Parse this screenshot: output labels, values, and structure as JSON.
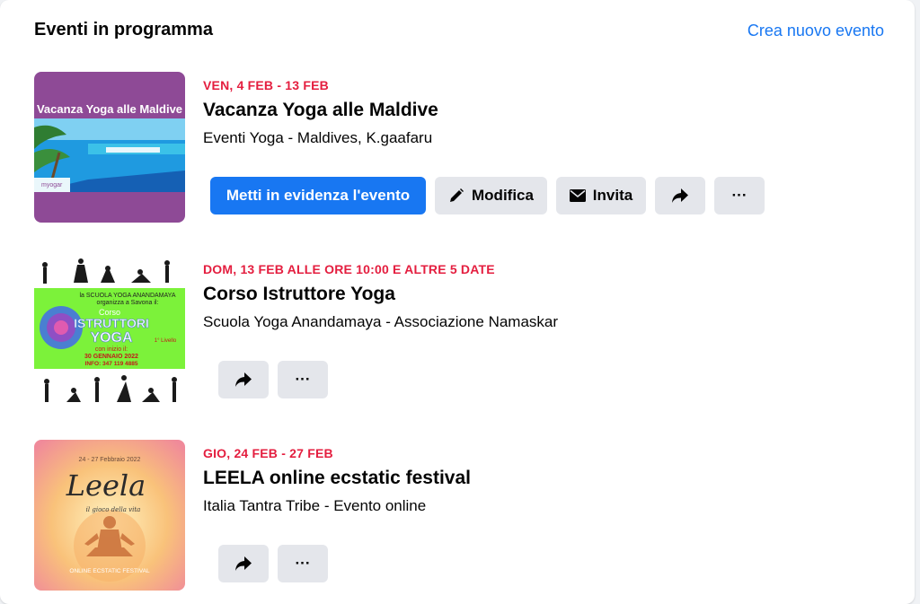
{
  "header": {
    "title": "Eventi in programma",
    "create_link": "Crea nuovo evento"
  },
  "events": [
    {
      "date": "VEN, 4 FEB - 13 FEB",
      "title": "Vacanza Yoga alle Maldive",
      "subtitle": "Eventi Yoga - Maldives, K.gaafaru",
      "thumb_text": "Vacanza Yoga alle Maldive",
      "thumb_small": "myogar",
      "buttons": {
        "promote": "Metti in evidenza l'evento",
        "edit": "Modifica",
        "invite": "Invita",
        "more": "···"
      }
    },
    {
      "date": "DOM, 13 FEB ALLE ORE 10:00 E ALTRE 5 DATE",
      "title": "Corso Istruttore Yoga",
      "subtitle": "Scuola Yoga Anandamaya - Associazione Namaskar",
      "thumb_lines": [
        "la SCUOLA YOGA ANANDAMAYA",
        "organizza a Savona il:",
        "Corso",
        "ISTRUTTORI",
        "YOGA",
        "con inizio il:",
        "30 GENNAIO 2022",
        "INFO: 347 119 4885",
        "1° Livello"
      ],
      "buttons": {
        "more": "···"
      }
    },
    {
      "date": "GIO, 24 FEB - 27 FEB",
      "title": "LEELA online ecstatic festival",
      "subtitle": "Italia Tantra Tribe - Evento online",
      "thumb_lines": [
        "24 - 27 Febbraio 2022",
        "Leela",
        "il gioco della vita",
        "ONLINE ECSTATIC FESTIVAL"
      ],
      "buttons": {
        "more": "···"
      }
    }
  ],
  "colors": {
    "accent": "#1877f2",
    "date_red": "#e41e3f",
    "button_gray": "#e4e6eb"
  }
}
